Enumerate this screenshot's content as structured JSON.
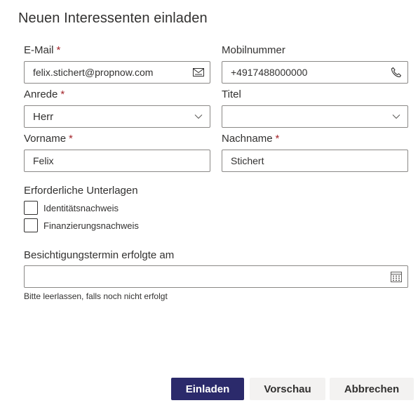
{
  "dialog": {
    "title": "Neuen Interessenten einladen"
  },
  "form": {
    "email": {
      "label": "E-Mail",
      "required": "*",
      "value": "felix.stichert@propnow.com",
      "icon": "mail-icon"
    },
    "mobile": {
      "label": "Mobilnummer",
      "value": "+4917488000000",
      "icon": "phone-icon"
    },
    "salutation": {
      "label": "Anrede",
      "required": "*",
      "value": "Herr",
      "icon": "chevron-down-icon"
    },
    "title": {
      "label": "Titel",
      "value": "",
      "icon": "chevron-down-icon"
    },
    "firstname": {
      "label": "Vorname",
      "required": "*",
      "value": "Felix"
    },
    "lastname": {
      "label": "Nachname",
      "required": "*",
      "value": "Stichert"
    },
    "documents": {
      "label": "Erforderliche Unterlagen",
      "items": [
        {
          "label": "Identitätsnachweis",
          "checked": false
        },
        {
          "label": "Finanzierungsnachweis",
          "checked": false
        }
      ]
    },
    "viewing": {
      "label": "Besichtigungstermin erfolgte am",
      "value": "",
      "icon": "calendar-icon",
      "helper": "Bitte leerlassen, falls noch nicht erfolgt"
    }
  },
  "actions": {
    "invite": "Einladen",
    "preview": "Vorschau",
    "cancel": "Abbrechen"
  },
  "colors": {
    "primary": "#2b2a6b",
    "required": "#a4262c",
    "border": "#8a8886",
    "secondary_bg": "#f3f2f1"
  }
}
